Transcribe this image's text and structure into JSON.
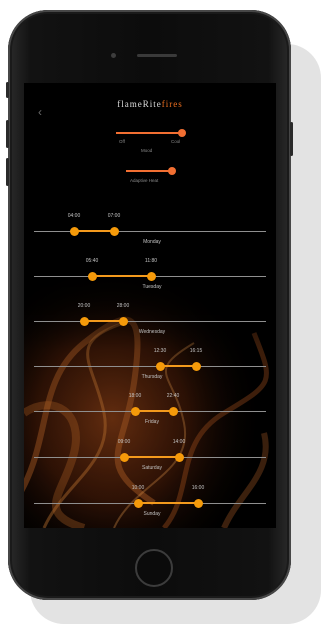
{
  "app": {
    "logo_primary": "flameRite",
    "logo_accent": "fires",
    "back_glyph": "‹",
    "accent_color": "#f26f32",
    "dot_color": "#f59a0a"
  },
  "controls": {
    "mode_off_label": "Off",
    "mode_on_label": "Cool",
    "mode_caption": "Mood",
    "mode_level": 1.0,
    "adaptive_label": "Adaptive Heat",
    "adaptive_level": 1.0
  },
  "schedule": [
    {
      "day": "Monday",
      "start": "04:00",
      "end": "07:00"
    },
    {
      "day": "Tuesday",
      "start": "05:40",
      "end": "11:80"
    },
    {
      "day": "Wednesday",
      "start": "20:00",
      "end": "28:00"
    },
    {
      "day": "Thursday",
      "start": "12:30",
      "end": "16:15"
    },
    {
      "day": "Friday",
      "start": "18:00",
      "end": "22:40"
    },
    {
      "day": "Saturday",
      "start": "09:00",
      "end": "14:00"
    },
    {
      "day": "Sunday",
      "start": "10:00",
      "end": "16:00"
    }
  ]
}
